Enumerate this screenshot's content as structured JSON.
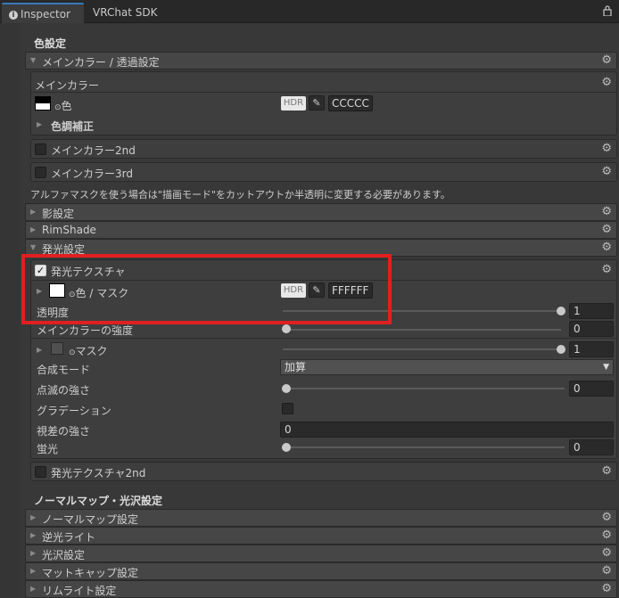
{
  "tabs": {
    "inspector": "Inspector",
    "vrchat_sdk": "VRChat SDK"
  },
  "color_settings": {
    "heading": "色設定",
    "main_color_bar": "メインカラー / 透過設定",
    "main_color_box_title": "メインカラー",
    "color_label": "色",
    "hdr": "HDR",
    "main_hex": "CCCCC",
    "color_adjust": "色調補正",
    "main_color_2nd": "メインカラー2nd",
    "main_color_3rd": "メインカラー3rd",
    "alpha_mask_note": "アルファマスクを使う場合は\"描画モード\"をカットアウトか半透明に変更する必要があります。"
  },
  "sections": {
    "shadow": "影設定",
    "rimshade": "RimShade",
    "emission": "発光設定"
  },
  "emission": {
    "texture_label": "発光テクスチャ",
    "color_mask_label": "色 / マスク",
    "hdr": "HDR",
    "hex": "FFFFFF",
    "opacity_label": "透明度",
    "opacity_value": "1",
    "main_color_strength_label": "メインカラーの強度",
    "main_color_strength_value": "0",
    "mask_label": "マスク",
    "mask_value": "1",
    "blend_mode_label": "合成モード",
    "blend_mode_value": "加算",
    "blink_strength_label": "点滅の強さ",
    "blink_strength_value": "0",
    "gradation_label": "グラデーション",
    "parallax_label": "視差の強さ",
    "parallax_value": "0",
    "fluorescence_label": "蛍光",
    "fluorescence_value": "0",
    "texture_2nd_label": "発光テクスチャ2nd"
  },
  "normal_section": {
    "heading": "ノーマルマップ・光沢設定",
    "items": [
      "ノーマルマップ設定",
      "逆光ライト",
      "光沢設定",
      "マットキャップ設定",
      "リムライト設定"
    ]
  },
  "colors": {
    "highlight": "#e02020",
    "tab_accent": "#3a79bb"
  }
}
